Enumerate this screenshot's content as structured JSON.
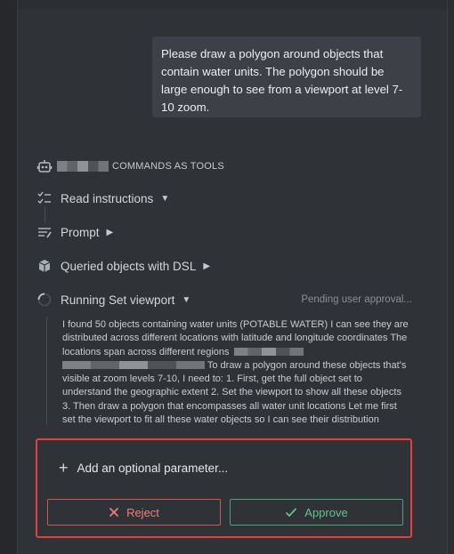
{
  "user_message": {
    "text": "Please draw a polygon around objects that contain water units. The polygon should be large enough to see from a viewport at level 7-10 zoom."
  },
  "agent": {
    "title_suffix": "COMMANDS AS TOOLS",
    "icon": "robot-icon"
  },
  "steps": [
    {
      "label": "Read instructions",
      "icon": "checklist-icon",
      "chevron": "▼"
    },
    {
      "label": "Prompt",
      "icon": "prompt-icon",
      "chevron": "▶"
    },
    {
      "label": "Queried objects with DSL",
      "icon": "cube-icon",
      "chevron": "▶"
    },
    {
      "label": "Running Set viewport",
      "icon": "spinner-icon",
      "chevron": "▼",
      "status": "Pending user approval..."
    }
  ],
  "thinking": {
    "part1": "I found 50 objects containing water units (POTABLE WATER) I can see they are distributed across different locations with latitude and longitude coordinates The locations span across different regions",
    "part2": "To draw a polygon around these objects that's visible at zoom levels 7-10, I need to: 1. First, get the full object set to understand the geographic extent 2. Set the viewport to show all these objects 3. Then draw a polygon that encompasses all water unit locations Let me first set the viewport to fit all these water objects so I can see their distribution"
  },
  "approval": {
    "add_param_label": "Add an optional parameter...",
    "reject_label": "Reject",
    "approve_label": "Approve",
    "colors": {
      "highlight": "#e4403d",
      "reject": "#ee7f7c",
      "approve": "#66c28a"
    }
  }
}
